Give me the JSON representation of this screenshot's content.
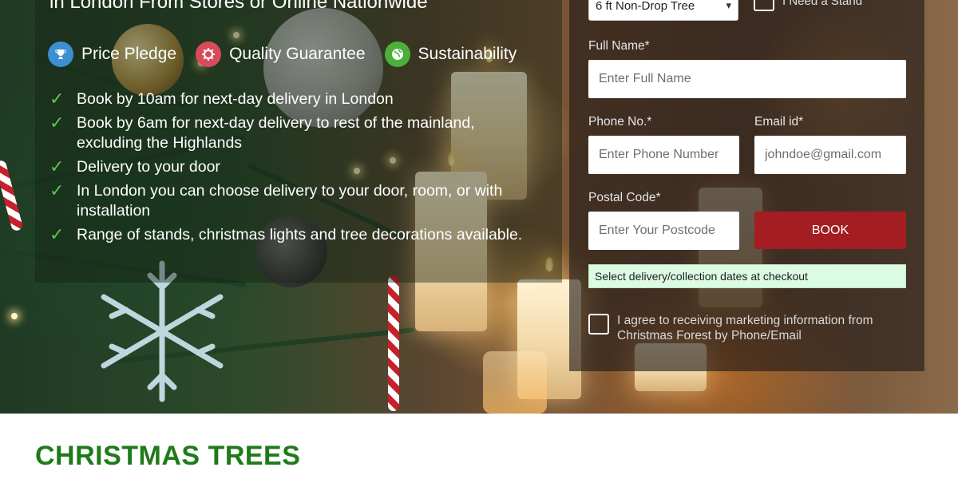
{
  "hero": {
    "headline": "in London From Stores or Online Nationwide",
    "features": [
      {
        "icon": "trophy-icon",
        "label": "Price Pledge",
        "color": "#3d8fd1"
      },
      {
        "icon": "gear-badge-icon",
        "label": "Quality Guarantee",
        "color": "#d94a5a"
      },
      {
        "icon": "globe-icon",
        "label": "Sustainability",
        "color": "#4caf3c"
      }
    ],
    "bullets": [
      "Book by 10am for next-day delivery in London",
      "Book by 6am for next-day delivery to rest of the mainland, excluding the Highlands",
      "Delivery to your door",
      "In London you can choose delivery to your door, room, or with installation",
      "Range of stands, christmas lights and tree decorations available."
    ]
  },
  "form": {
    "tree_select": {
      "value": "6 ft Non-Drop Tree"
    },
    "stand_label": "I Need a Stand",
    "full_name": {
      "label": "Full Name*",
      "placeholder": "Enter Full Name"
    },
    "phone": {
      "label": "Phone No.*",
      "placeholder": "Enter Phone Number"
    },
    "email": {
      "label": "Email id*",
      "placeholder": "johndoe@gmail.com"
    },
    "postcode": {
      "label": "Postal Code*",
      "placeholder": "Enter Your Postcode"
    },
    "book_label": "BOOK",
    "delivery_note": "Select delivery/collection dates at checkout",
    "agree_text": "I agree to receiving marketing information from Christmas Forest by Phone/Email"
  },
  "section": {
    "title": "CHRISTMAS TREES"
  },
  "colors": {
    "accent_red": "#a31d22",
    "brand_green": "#1f7a1a",
    "check_green": "#5cc24a"
  }
}
